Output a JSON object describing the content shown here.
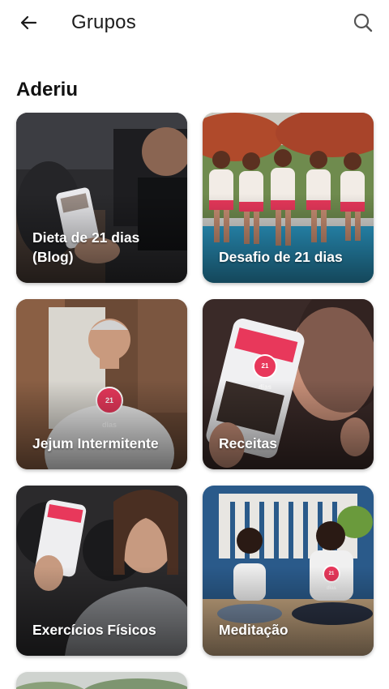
{
  "header": {
    "title": "Grupos",
    "back_icon": "arrow-left-icon",
    "search_icon": "search-icon"
  },
  "section": {
    "title": "Aderiu"
  },
  "groups": [
    {
      "label": "Dieta de 21 dias (Blog)",
      "image": "person-using-phone-app"
    },
    {
      "label": "Desafio de 21 dias",
      "image": "women-by-pool-21-dias-shirts"
    },
    {
      "label": "Jejum Intermitente",
      "image": "man-in-21-dias-shirt"
    },
    {
      "label": "Receitas",
      "image": "woman-holding-phone-recipes"
    },
    {
      "label": "Exercícios Físicos",
      "image": "woman-holding-phone-exercise"
    },
    {
      "label": "Meditação",
      "image": "mother-daughter-meditating"
    },
    {
      "label": "",
      "image": "outdoor-trees"
    }
  ],
  "badge_text": "21 dias",
  "colors": {
    "brand": "#e8385b",
    "text": "#1c1c1c",
    "background": "#ffffff"
  }
}
